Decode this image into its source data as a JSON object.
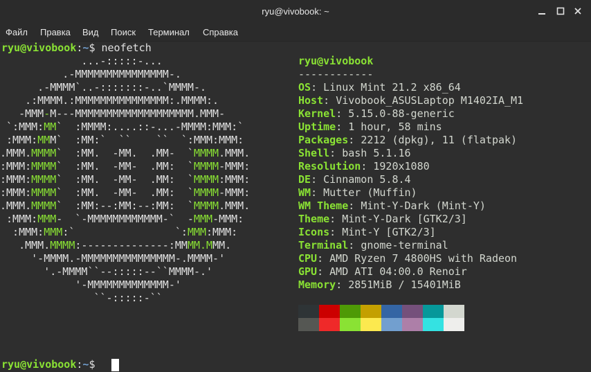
{
  "window": {
    "title": "ryu@vivobook: ~"
  },
  "menu": [
    {
      "label": "Файл"
    },
    {
      "label": "Правка"
    },
    {
      "label": "Вид"
    },
    {
      "label": "Поиск"
    },
    {
      "label": "Терминал"
    },
    {
      "label": "Справка"
    }
  ],
  "prompt": {
    "user_host": "ryu@vivobook",
    "colon": ":",
    "path": "~",
    "symbol": "$",
    "command": " neofetch"
  },
  "logo_lines": [
    "             ...-:::::-...",
    "          .-MMMMMMMMMMMMMMM-.",
    "      .-MMMM`..-:::::::-..`MMMM-.",
    "    .:MMMM.:MMMMMMMMMMMMMMM:.MMMM:.",
    "   -MMM-M---MMMMMMMMMMMMMMMMMMM.MMM-",
    " `:MMM:MM`  :MMMM:....::-...-MMMM:MMM:`",
    " :MMM:MMM`  :MM:`  ``    ``  `:MMM:MMM:",
    ".MMM.MMMM`  :MM.  -MM.  .MM-  `MMMM.MMM.",
    ":MMM:MMMM`  :MM.  -MM-  .MM:  `MMMM-MMM:",
    ":MMM:MMMM`  :MM.  -MM-  .MM:  `MMMM:MMM:",
    ":MMM:MMMM`  :MM.  -MM-  .MM:  `MMMM-MMM:",
    ".MMM.MMMM`  :MM:--:MM:--:MM:  `MMMM.MMM.",
    " :MMM:MMM-  `-MMMMMMMMMMMM-`  -MMM-MMM:",
    "  :MMM:MMM:`                `:MMM:MMM:",
    "   .MMM.MMMM:--------------:MMMM.MMM.",
    "     '-MMMM.-MMMMMMMMMMMMMMM-.MMMM-'",
    "       '.-MMMM``--:::::--``MMMM-.'",
    "            '-MMMMMMMMMMMMM-'",
    "               ``-:::::-``"
  ],
  "info": {
    "header": "ryu@vivobook",
    "separator": "------------",
    "rows": [
      {
        "key": "OS",
        "value": "Linux Mint 21.2 x86_64"
      },
      {
        "key": "Host",
        "value": "Vivobook_ASUSLaptop M1402IA_M1"
      },
      {
        "key": "Kernel",
        "value": "5.15.0-88-generic"
      },
      {
        "key": "Uptime",
        "value": "1 hour, 58 mins"
      },
      {
        "key": "Packages",
        "value": "2212 (dpkg), 11 (flatpak)"
      },
      {
        "key": "Shell",
        "value": "bash 5.1.16"
      },
      {
        "key": "Resolution",
        "value": "1920x1080"
      },
      {
        "key": "DE",
        "value": "Cinnamon 5.8.4"
      },
      {
        "key": "WM",
        "value": "Mutter (Muffin)"
      },
      {
        "key": "WM Theme",
        "value": "Mint-Y-Dark (Mint-Y)"
      },
      {
        "key": "Theme",
        "value": "Mint-Y-Dark [GTK2/3]"
      },
      {
        "key": "Icons",
        "value": "Mint-Y [GTK2/3]"
      },
      {
        "key": "Terminal",
        "value": "gnome-terminal"
      },
      {
        "key": "CPU",
        "value": "AMD Ryzen 7 4800HS with Radeon"
      },
      {
        "key": "GPU",
        "value": "AMD ATI 04:00.0 Renoir"
      },
      {
        "key": "Memory",
        "value": "2851MiB / 15401MiB"
      }
    ]
  },
  "palette": {
    "normal": [
      "#2e3436",
      "#cc0000",
      "#4e9a06",
      "#c4a000",
      "#3465a4",
      "#75507b",
      "#06989a",
      "#d3d7cf"
    ],
    "bright": [
      "#555753",
      "#ef2929",
      "#8ae234",
      "#fce94f",
      "#729fcf",
      "#ad7fa8",
      "#34e2e2",
      "#eeeeec"
    ]
  },
  "icons": {
    "minimize": "minimize-icon",
    "maximize": "maximize-icon",
    "close": "close-icon"
  }
}
